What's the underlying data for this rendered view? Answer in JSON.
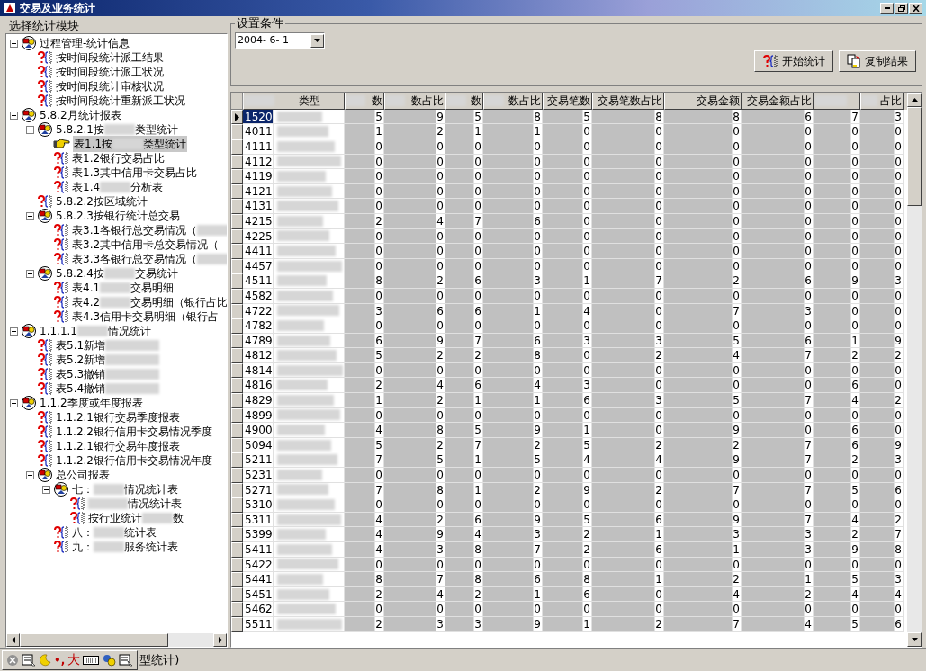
{
  "window": {
    "title": "交易及业务统计"
  },
  "left_panel": {
    "title": "选择统计模块",
    "tree": [
      {
        "kind": "folder",
        "expanded": true,
        "selected": false,
        "parts": [
          "过程管理-统计信息"
        ],
        "children": [
          {
            "kind": "report",
            "selected": false,
            "parts": [
              "按时间段统计派工结果"
            ]
          },
          {
            "kind": "report",
            "selected": false,
            "parts": [
              "按时间段统计派工状况"
            ]
          },
          {
            "kind": "report",
            "selected": false,
            "parts": [
              "按时间段统计审核状况"
            ]
          },
          {
            "kind": "report",
            "selected": false,
            "parts": [
              "按时间段统计重新派工状况"
            ]
          }
        ]
      },
      {
        "kind": "folder",
        "expanded": true,
        "selected": false,
        "parts": [
          "5.8.2月统计报表"
        ],
        "children": [
          {
            "kind": "folder",
            "expanded": true,
            "selected": false,
            "parts": [
              "5.8.2.1按",
              "类型统计"
            ],
            "children": [
              {
                "kind": "report",
                "selected": true,
                "parts": [
                  "表1.1按",
                  "类型统计"
                ]
              },
              {
                "kind": "report",
                "selected": false,
                "parts": [
                  "表1.2银行交易占比"
                ]
              },
              {
                "kind": "report",
                "selected": false,
                "parts": [
                  "表1.3其中信用卡交易占比"
                ]
              },
              {
                "kind": "report",
                "selected": false,
                "parts": [
                  "表1.4",
                  "分析表"
                ]
              }
            ]
          },
          {
            "kind": "report",
            "selected": false,
            "parts": [
              "5.8.2.2按区域统计"
            ]
          },
          {
            "kind": "folder",
            "expanded": true,
            "selected": false,
            "parts": [
              "5.8.2.3按银行统计总交易"
            ],
            "children": [
              {
                "kind": "report",
                "selected": false,
                "blur_after": true,
                "parts": [
                  "表3.1各银行总交易情况（"
                ]
              },
              {
                "kind": "report",
                "selected": false,
                "parts": [
                  "表3.2其中信用卡总交易情况（"
                ]
              },
              {
                "kind": "report",
                "selected": false,
                "blur_after": true,
                "parts": [
                  "表3.3各银行总交易情况（"
                ]
              }
            ]
          },
          {
            "kind": "folder",
            "expanded": true,
            "selected": false,
            "parts": [
              "5.8.2.4按",
              "交易统计"
            ],
            "children": [
              {
                "kind": "report",
                "selected": false,
                "parts": [
                  "表4.1",
                  "交易明细"
                ]
              },
              {
                "kind": "report",
                "selected": false,
                "parts": [
                  "表4.2",
                  "交易明细（银行占比"
                ]
              },
              {
                "kind": "report",
                "selected": false,
                "parts": [
                  "表4.3信用卡交易明细（银行占"
                ]
              }
            ]
          }
        ]
      },
      {
        "kind": "folder",
        "expanded": true,
        "selected": false,
        "parts": [
          "1.1.1.1",
          "情况统计"
        ],
        "children": [
          {
            "kind": "report",
            "selected": false,
            "blur_after": true,
            "parts": [
              "表5.1新增"
            ]
          },
          {
            "kind": "report",
            "selected": false,
            "blur_after": true,
            "parts": [
              "表5.2新增"
            ]
          },
          {
            "kind": "report",
            "selected": false,
            "blur_after": true,
            "parts": [
              "表5.3撤销"
            ]
          },
          {
            "kind": "report",
            "selected": false,
            "blur_after": true,
            "parts": [
              "表5.4撤销"
            ]
          }
        ]
      },
      {
        "kind": "folder",
        "expanded": true,
        "selected": false,
        "parts": [
          "1.1.2季度或年度报表"
        ],
        "children": [
          {
            "kind": "report",
            "selected": false,
            "parts": [
              "1.1.2.1银行交易季度报表"
            ]
          },
          {
            "kind": "report",
            "selected": false,
            "parts": [
              "1.1.2.2银行信用卡交易情况季度"
            ]
          },
          {
            "kind": "report",
            "selected": false,
            "parts": [
              "1.1.2.1银行交易年度报表"
            ]
          },
          {
            "kind": "report",
            "selected": false,
            "parts": [
              "1.1.2.2银行信用卡交易情况年度"
            ]
          },
          {
            "kind": "folder",
            "expanded": true,
            "selected": false,
            "parts": [
              "总公司报表"
            ],
            "children": [
              {
                "kind": "folder",
                "expanded": true,
                "selected": false,
                "parts": [
                  "七：",
                  "情况统计表"
                ],
                "children": [
                  {
                    "kind": "report",
                    "selected": false,
                    "blur_before": true,
                    "parts": [
                      "情况统计表"
                    ]
                  },
                  {
                    "kind": "report",
                    "selected": false,
                    "parts": [
                      "按行业统计",
                      "数"
                    ]
                  }
                ]
              },
              {
                "kind": "report",
                "selected": false,
                "parts": [
                  "八：",
                  "统计表"
                ]
              },
              {
                "kind": "report",
                "selected": false,
                "parts": [
                  "九：",
                  "服务统计表"
                ]
              }
            ]
          }
        ]
      }
    ]
  },
  "conditions": {
    "title": "设置条件",
    "date": "2004- 6- 1",
    "buttons": [
      {
        "kind": "run",
        "label": "开始统计"
      },
      {
        "kind": "copy",
        "label": "复制结果"
      }
    ]
  },
  "table": {
    "columns": [
      "类型",
      "数",
      "数占比",
      "数",
      "数占比",
      "交易笔数",
      "交易笔数占比",
      "交易金额",
      "交易金额占比",
      "占比"
    ],
    "rows": [
      {
        "code": "1520",
        "selected": true,
        "values": [
          "5",
          "9",
          "5",
          "8",
          "5",
          "8",
          "8",
          "6",
          "7",
          "3"
        ]
      },
      {
        "code": "4011",
        "selected": false,
        "values": [
          "1",
          "2",
          "1",
          "1",
          "0",
          "0",
          "0",
          "0",
          "0",
          "0"
        ]
      },
      {
        "code": "4111",
        "selected": false,
        "values": [
          "0",
          "0",
          "0",
          "0",
          "0",
          "0",
          "0",
          "0",
          "0",
          "0"
        ]
      },
      {
        "code": "4112",
        "selected": false,
        "values": [
          "0",
          "0",
          "0",
          "0",
          "0",
          "0",
          "0",
          "0",
          "0",
          "0"
        ]
      },
      {
        "code": "4119",
        "selected": false,
        "values": [
          "0",
          "0",
          "0",
          "0",
          "0",
          "0",
          "0",
          "0",
          "0",
          "0"
        ]
      },
      {
        "code": "4121",
        "selected": false,
        "values": [
          "0",
          "0",
          "0",
          "0",
          "0",
          "0",
          "0",
          "0",
          "0",
          "0"
        ]
      },
      {
        "code": "4131",
        "selected": false,
        "values": [
          "0",
          "0",
          "0",
          "0",
          "0",
          "0",
          "0",
          "0",
          "0",
          "0"
        ]
      },
      {
        "code": "4215",
        "selected": false,
        "values": [
          "2",
          "4",
          "7",
          "6",
          "0",
          "0",
          "0",
          "0",
          "0",
          "0"
        ]
      },
      {
        "code": "4225",
        "selected": false,
        "values": [
          "0",
          "0",
          "0",
          "0",
          "0",
          "0",
          "0",
          "0",
          "0",
          "0"
        ]
      },
      {
        "code": "4411",
        "selected": false,
        "values": [
          "0",
          "0",
          "0",
          "0",
          "0",
          "0",
          "0",
          "0",
          "0",
          "0"
        ]
      },
      {
        "code": "4457",
        "selected": false,
        "values": [
          "0",
          "0",
          "0",
          "0",
          "0",
          "0",
          "0",
          "0",
          "0",
          "0"
        ]
      },
      {
        "code": "4511",
        "selected": false,
        "values": [
          "8",
          "2",
          "6",
          "3",
          "1",
          "7",
          "2",
          "6",
          "9",
          "3"
        ]
      },
      {
        "code": "4582",
        "selected": false,
        "values": [
          "0",
          "0",
          "0",
          "0",
          "0",
          "0",
          "0",
          "0",
          "0",
          "0"
        ]
      },
      {
        "code": "4722",
        "selected": false,
        "values": [
          "3",
          "6",
          "6",
          "1",
          "4",
          "0",
          "7",
          "3",
          "0",
          "0"
        ]
      },
      {
        "code": "4782",
        "selected": false,
        "values": [
          "0",
          "0",
          "0",
          "0",
          "0",
          "0",
          "0",
          "0",
          "0",
          "0"
        ]
      },
      {
        "code": "4789",
        "selected": false,
        "values": [
          "6",
          "9",
          "7",
          "6",
          "3",
          "3",
          "5",
          "6",
          "1",
          "9"
        ]
      },
      {
        "code": "4812",
        "selected": false,
        "values": [
          "5",
          "2",
          "2",
          "8",
          "0",
          "2",
          "4",
          "7",
          "2",
          "2"
        ]
      },
      {
        "code": "4814",
        "selected": false,
        "values": [
          "0",
          "0",
          "0",
          "0",
          "0",
          "0",
          "0",
          "0",
          "0",
          "0"
        ]
      },
      {
        "code": "4816",
        "selected": false,
        "values": [
          "2",
          "4",
          "6",
          "4",
          "3",
          "0",
          "0",
          "0",
          "6",
          "0"
        ]
      },
      {
        "code": "4829",
        "selected": false,
        "values": [
          "1",
          "2",
          "1",
          "1",
          "6",
          "3",
          "5",
          "7",
          "4",
          "2"
        ]
      },
      {
        "code": "4899",
        "selected": false,
        "values": [
          "0",
          "0",
          "0",
          "0",
          "0",
          "0",
          "0",
          "0",
          "0",
          "0"
        ]
      },
      {
        "code": "4900",
        "selected": false,
        "values": [
          "4",
          "8",
          "5",
          "9",
          "1",
          "0",
          "9",
          "0",
          "6",
          "0"
        ]
      },
      {
        "code": "5094",
        "selected": false,
        "values": [
          "5",
          "2",
          "7",
          "2",
          "5",
          "2",
          "2",
          "7",
          "6",
          "9"
        ]
      },
      {
        "code": "5211",
        "selected": false,
        "values": [
          "7",
          "5",
          "1",
          "5",
          "4",
          "4",
          "9",
          "7",
          "2",
          "3"
        ]
      },
      {
        "code": "5231",
        "selected": false,
        "values": [
          "0",
          "0",
          "0",
          "0",
          "0",
          "0",
          "0",
          "0",
          "0",
          "0"
        ]
      },
      {
        "code": "5271",
        "selected": false,
        "values": [
          "7",
          "8",
          "1",
          "2",
          "9",
          "2",
          "7",
          "7",
          "5",
          "6"
        ]
      },
      {
        "code": "5310",
        "selected": false,
        "values": [
          "0",
          "0",
          "0",
          "0",
          "0",
          "0",
          "0",
          "0",
          "0",
          "0"
        ]
      },
      {
        "code": "5311",
        "selected": false,
        "values": [
          "4",
          "2",
          "6",
          "9",
          "5",
          "6",
          "9",
          "7",
          "4",
          "2"
        ]
      },
      {
        "code": "5399",
        "selected": false,
        "values": [
          "4",
          "9",
          "4",
          "3",
          "2",
          "1",
          "3",
          "3",
          "2",
          "7"
        ]
      },
      {
        "code": "5411",
        "selected": false,
        "values": [
          "4",
          "3",
          "8",
          "7",
          "2",
          "6",
          "1",
          "3",
          "9",
          "8"
        ]
      },
      {
        "code": "5422",
        "selected": false,
        "values": [
          "0",
          "0",
          "0",
          "0",
          "0",
          "0",
          "0",
          "0",
          "0",
          "0"
        ]
      },
      {
        "code": "5441",
        "selected": false,
        "values": [
          "8",
          "7",
          "8",
          "6",
          "8",
          "1",
          "2",
          "1",
          "5",
          "3"
        ]
      },
      {
        "code": "5451",
        "selected": false,
        "values": [
          "2",
          "4",
          "2",
          "1",
          "6",
          "0",
          "4",
          "2",
          "4",
          "4"
        ]
      },
      {
        "code": "5462",
        "selected": false,
        "values": [
          "0",
          "0",
          "0",
          "0",
          "0",
          "0",
          "0",
          "0",
          "0",
          "0"
        ]
      },
      {
        "code": "5511",
        "selected": false,
        "values": [
          "2",
          "3",
          "3",
          "9",
          "1",
          "2",
          "7",
          "4",
          "5",
          "6"
        ]
      }
    ]
  },
  "ime_toolbar": {
    "punct": "•,",
    "width_mode": "大"
  },
  "status_bar": {
    "text": "型统计)"
  }
}
